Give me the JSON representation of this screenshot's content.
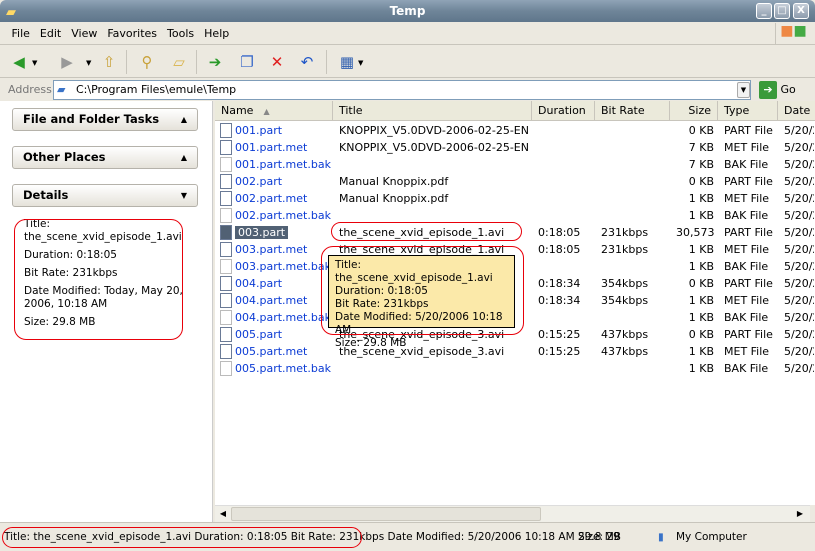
{
  "window": {
    "title": "Temp",
    "controls": [
      "_",
      "□",
      "X"
    ]
  },
  "menu": [
    "File",
    "Edit",
    "View",
    "Favorites",
    "Tools",
    "Help"
  ],
  "toolbar": [
    {
      "icon": "back-icon",
      "glyph": "◀",
      "color": "#2a9a2a"
    },
    {
      "icon": "forward-icon",
      "glyph": "▶",
      "color": "#999999"
    },
    {
      "icon": "up-folder-icon",
      "glyph": "⇧",
      "color": "#c9a23a"
    },
    {
      "icon": "search-icon",
      "glyph": "⚲",
      "color": "#c9a23a"
    },
    {
      "icon": "folders-icon",
      "glyph": "▱",
      "color": "#d9b34a"
    },
    {
      "icon": "move-to-icon",
      "glyph": "➔",
      "color": "#2a9a2a"
    },
    {
      "icon": "copy-to-icon",
      "glyph": "❐",
      "color": "#3a6acb"
    },
    {
      "icon": "delete-icon",
      "glyph": "✕",
      "color": "#e02020"
    },
    {
      "icon": "undo-icon",
      "glyph": "↶",
      "color": "#1f56c8"
    },
    {
      "icon": "views-icon",
      "glyph": "▦",
      "color": "#2f5fb0"
    }
  ],
  "address": {
    "label": "Address",
    "value": "C:\\Program Files\\emule\\Temp",
    "go": "Go"
  },
  "left": {
    "panels": [
      {
        "label": "File and Folder Tasks",
        "arrow": "▲"
      },
      {
        "label": "Other Places",
        "arrow": "▲"
      },
      {
        "label": "Details",
        "arrow": "▼"
      }
    ],
    "details": [
      "Title: the_scene_xvid_episode_1.avi",
      "Duration: 0:18:05",
      "Bit Rate: 231kbps",
      "Date Modified: Today, May 20, 2006, 10:18 AM",
      "Size: 29.8 MB"
    ]
  },
  "columns": [
    "Name",
    "Title",
    "Duration",
    "Bit Rate",
    "Size",
    "Type",
    "Date"
  ],
  "sort_indicator": "▲",
  "files": [
    [
      "001.part",
      "KNOPPIX_V5.0DVD-2006-02-25-EN.iso",
      "",
      "",
      "0 KB",
      "PART File",
      "5/20/2"
    ],
    [
      "001.part.met",
      "KNOPPIX_V5.0DVD-2006-02-25-EN.iso",
      "",
      "",
      "7 KB",
      "MET File",
      "5/20/2"
    ],
    [
      "001.part.met.bak",
      "",
      "",
      "",
      "7 KB",
      "BAK File",
      "5/20/2"
    ],
    [
      "002.part",
      "Manual Knoppix.pdf",
      "",
      "",
      "0 KB",
      "PART File",
      "5/20/2"
    ],
    [
      "002.part.met",
      "Manual Knoppix.pdf",
      "",
      "",
      "1 KB",
      "MET File",
      "5/20/2"
    ],
    [
      "002.part.met.bak",
      "",
      "",
      "",
      "1 KB",
      "BAK File",
      "5/20/2"
    ],
    [
      "003.part",
      "the_scene_xvid_episode_1.avi",
      "0:18:05",
      "231kbps",
      "30,573 KB",
      "PART File",
      "5/20/2"
    ],
    [
      "003.part.met",
      "the_scene_xvid_episode_1.avi",
      "0:18:05",
      "231kbps",
      "1 KB",
      "MET File",
      "5/20/2"
    ],
    [
      "003.part.met.bak",
      "",
      "",
      "",
      "1 KB",
      "BAK File",
      "5/20/2"
    ],
    [
      "004.part",
      "",
      "0:18:34",
      "354kbps",
      "0 KB",
      "PART File",
      "5/20/2"
    ],
    [
      "004.part.met",
      "",
      "0:18:34",
      "354kbps",
      "1 KB",
      "MET File",
      "5/20/2"
    ],
    [
      "004.part.met.bak",
      "",
      "",
      "",
      "1 KB",
      "BAK File",
      "5/20/2"
    ],
    [
      "005.part",
      "the_scene_xvid_episode_3.avi",
      "0:15:25",
      "437kbps",
      "0 KB",
      "PART File",
      "5/20/2"
    ],
    [
      "005.part.met",
      "the_scene_xvid_episode_3.avi",
      "0:15:25",
      "437kbps",
      "1 KB",
      "MET File",
      "5/20/2"
    ],
    [
      "005.part.met.bak",
      "",
      "",
      "",
      "1 KB",
      "BAK File",
      "5/20/2"
    ]
  ],
  "selected_index": 6,
  "tooltip": [
    "Title: the_scene_xvid_episode_1.avi",
    "Duration: 0:18:05",
    "Bit Rate: 231kbps",
    "Date Modified: 5/20/2006 10:18 AM",
    "Size: 29.8 MB"
  ],
  "status": {
    "left": "Title: the_scene_xvid_episode_1.avi Duration: 0:18:05 Bit Rate: 231kbps Date Modified: 5/20/2006 10:18 AM Size: 29",
    "size": "29.8 MB",
    "zone": "My Computer"
  },
  "colors": {
    "annotation": "#e8000a",
    "link": "#0a3ad4",
    "selection": "#516174",
    "tooltip": "#fbe9a9"
  }
}
